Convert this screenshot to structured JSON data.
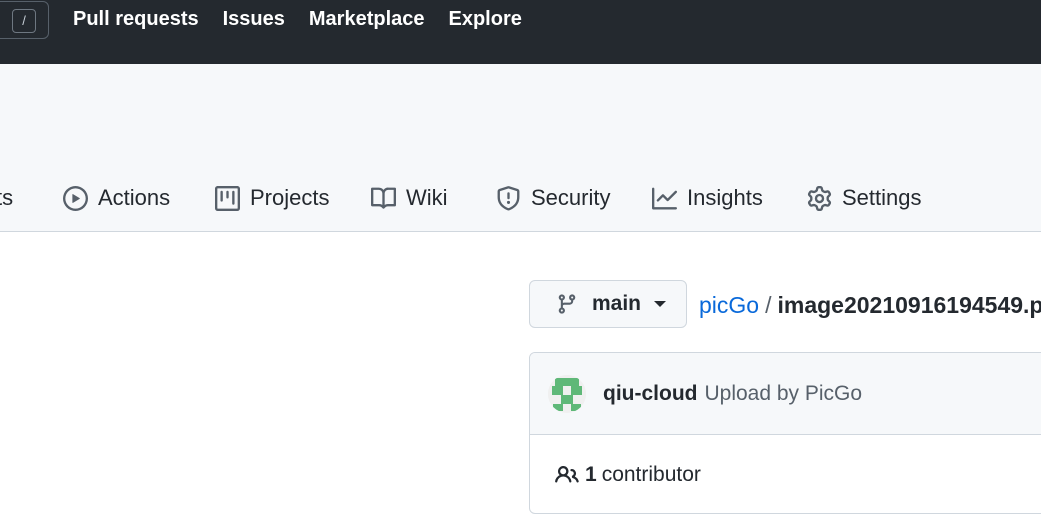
{
  "header": {
    "slash_key": "/",
    "nav": [
      "Pull requests",
      "Issues",
      "Marketplace",
      "Explore"
    ]
  },
  "repo_tabs": {
    "partial_tab": "ts",
    "items": [
      {
        "label": "Actions",
        "icon": "play-circle-icon"
      },
      {
        "label": "Projects",
        "icon": "project-board-icon"
      },
      {
        "label": "Wiki",
        "icon": "book-icon"
      },
      {
        "label": "Security",
        "icon": "shield-icon"
      },
      {
        "label": "Insights",
        "icon": "graph-icon"
      },
      {
        "label": "Settings",
        "icon": "gear-icon"
      }
    ]
  },
  "branch": {
    "name": "main"
  },
  "breadcrumb": {
    "repo": "picGo",
    "separator": "/",
    "file": "image20210916194549.p"
  },
  "commit": {
    "author": "qiu-cloud",
    "message": "Upload by PicGo"
  },
  "contributors": {
    "count": "1",
    "label": "contributor"
  },
  "colors": {
    "header_bg": "#24292f",
    "link": "#0969da",
    "subtle_bg": "#f6f8fa",
    "border": "#d0d7de",
    "avatar_green": "#5fb878"
  }
}
